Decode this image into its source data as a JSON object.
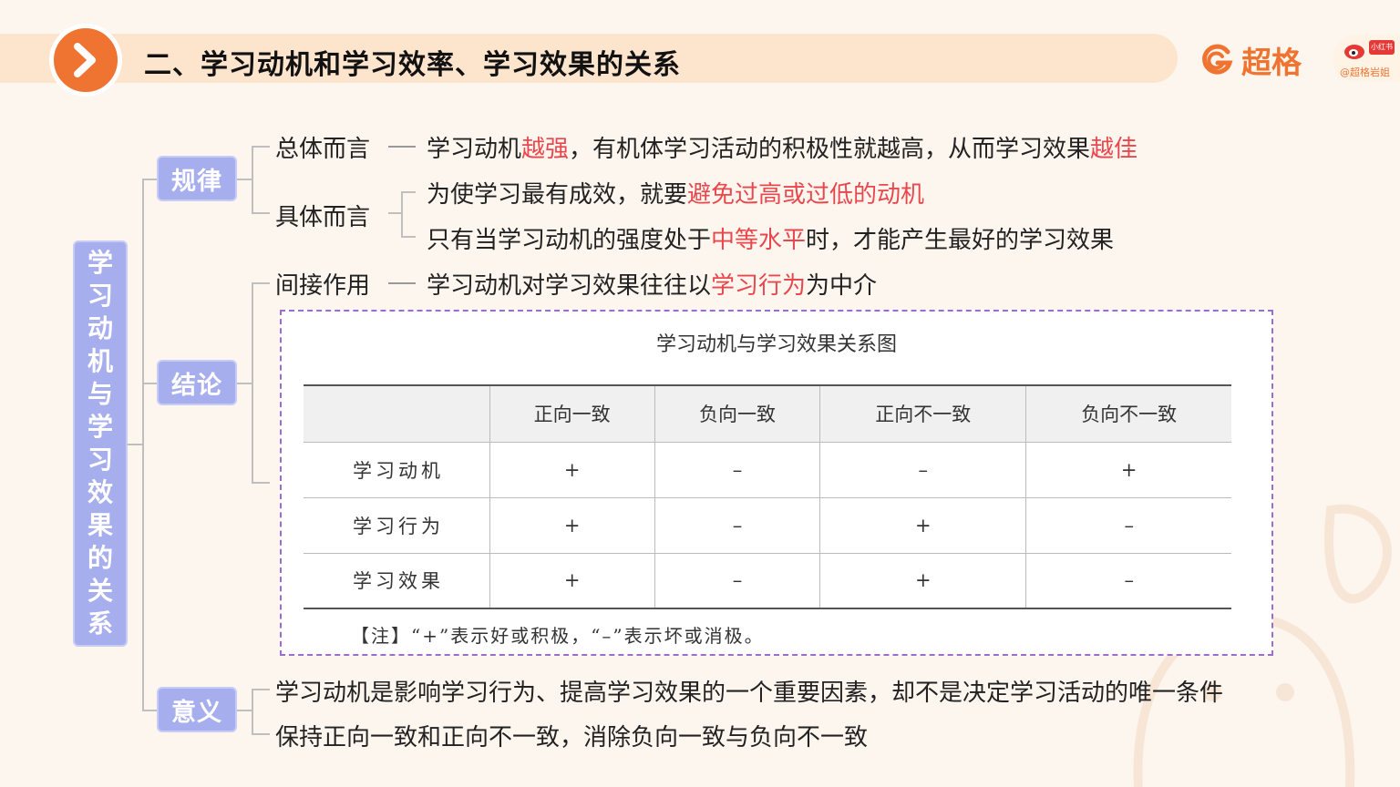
{
  "header": {
    "title": "二、学习动机和学习效率、学习效果的关系",
    "brand_name": "超格",
    "social_badge": "小红书",
    "social_handle": "@超格岩姐"
  },
  "root": {
    "chars": [
      "学",
      "习",
      "动",
      "机",
      "与",
      "学",
      "习",
      "效",
      "果",
      "的",
      "关",
      "系"
    ]
  },
  "nodes": {
    "guilv": "规律",
    "jielun": "结论",
    "yiyi": "意义"
  },
  "guilv": {
    "overall_label": "总体而言",
    "overall_parts": [
      "学习动机",
      "越强",
      "，有机体学习活动的积极性就越高，从而学习效果",
      "越佳"
    ],
    "specific_label": "具体而言",
    "specific_1_parts": [
      "为使学习最有成效，就要",
      "避免过高或过低的动机"
    ],
    "specific_2_parts": [
      "只有当学习动机的强度处于",
      "中等水平",
      "时，才能产生最好的学习效果"
    ]
  },
  "jielun": {
    "indirect_label": "间接作用",
    "indirect_parts": [
      "学习动机对学习效果往往以",
      "学习行为",
      "为中介"
    ]
  },
  "table": {
    "title": "学习动机与学习效果关系图",
    "headers": [
      "",
      "正向一致",
      "负向一致",
      "正向不一致",
      "负向不一致"
    ],
    "rows": [
      [
        "学习动机",
        "+",
        "–",
        "–",
        "+"
      ],
      [
        "学习行为",
        "+",
        "–",
        "+",
        "–"
      ],
      [
        "学习效果",
        "+",
        "–",
        "+",
        "–"
      ]
    ],
    "note": "【注】“+”表示好或积极，“–”表示坏或消极。"
  },
  "yiyi": {
    "line_1": "学习动机是影响学习行为、提高学习效果的一个重要因素，却不是决定学习活动的唯一条件",
    "line_2": "保持正向一致和正向不一致，消除负向一致与负向不一致"
  },
  "colors": {
    "accent_orange": "#f07431",
    "node_purple": "#a7aeee",
    "highlight_red": "#e8484d",
    "card_border": "#9c6ccf"
  }
}
